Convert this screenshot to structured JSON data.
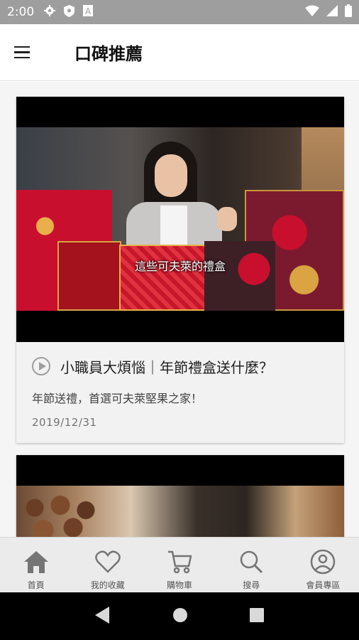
{
  "status_bar": {
    "time": "2:00",
    "icons_left": [
      "gear-icon",
      "shield-icon",
      "a-icon"
    ],
    "icons_right": [
      "wifi-icon",
      "signal-icon",
      "battery-icon"
    ]
  },
  "app_bar": {
    "title": "口碑推薦"
  },
  "cards": [
    {
      "subtitle": "這些可夫萊的禮盒",
      "title": "小職員大煩惱｜年節禮盒送什麼？",
      "description": "年節送禮，首選可夫萊堅果之家！",
      "date": "2019/12/31"
    }
  ],
  "bottom_nav": [
    {
      "label": "首頁",
      "icon": "home-icon",
      "active": true
    },
    {
      "label": "我的收藏",
      "icon": "heart-icon",
      "active": false
    },
    {
      "label": "購物車",
      "icon": "cart-icon",
      "active": false
    },
    {
      "label": "搜尋",
      "icon": "search-icon",
      "active": false
    },
    {
      "label": "會員專區",
      "icon": "account-icon",
      "active": false
    }
  ],
  "colors": {
    "status_bar": "#9e9e9e",
    "nav_bg": "#ebebeb",
    "icon_gray": "#757575"
  }
}
